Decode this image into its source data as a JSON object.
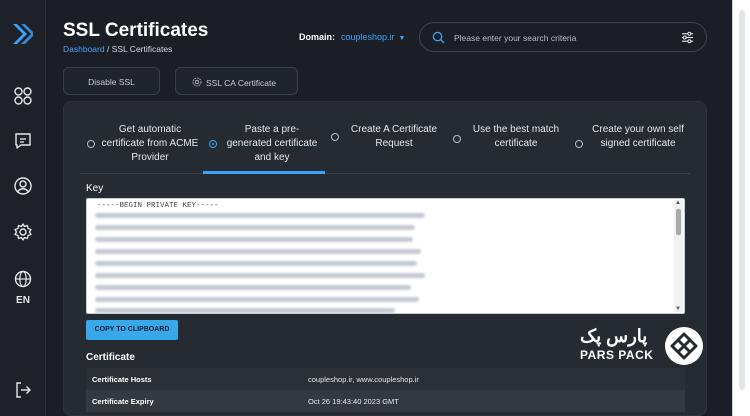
{
  "header": {
    "title": "SSL Certificates",
    "breadcrumb_link": "Dashboard",
    "breadcrumb_sep": " / ",
    "breadcrumb_current": "SSL Certificates",
    "domain_label": "Domain:",
    "domain_value": "coupleshop.ir"
  },
  "search": {
    "placeholder": "Please enter your search criteria"
  },
  "toolbar": {
    "disable_ssl": "Disable SSL",
    "ssl_ca_certificate": "SSL CA Certificate"
  },
  "sidebar": {
    "language": "EN"
  },
  "tabs": [
    {
      "label": "Get automatic certificate from ACME Provider",
      "selected": false
    },
    {
      "label": "Paste a pre-generated certificate and key",
      "selected": true
    },
    {
      "label": "Create A Certificate Request",
      "selected": false
    },
    {
      "label": "Use the best match certificate",
      "selected": false
    },
    {
      "label": "Create your own self signed certificate",
      "selected": false
    }
  ],
  "key_section": {
    "label": "Key",
    "first_line": "-----BEGIN PRIVATE KEY-----"
  },
  "copy_button": "COPY TO CLIPBOARD",
  "certificate": {
    "label": "Certificate",
    "rows": [
      {
        "key": "Certificate Hosts",
        "value": "coupleshop.ir, www.coupleshop.ir"
      },
      {
        "key": "Certificate Expiry",
        "value": "Oct 26 19:43:40 2023 GMT"
      }
    ]
  },
  "watermark": {
    "persian": "پارس پک",
    "english": "PARS PACK"
  },
  "colors": {
    "accent": "#3aa3ff",
    "button": "#38a8ea",
    "background": "#1b1e24",
    "panel": "#262a31"
  },
  "icons": [
    "logo-icon",
    "dashboard-grid-icon",
    "chat-icon",
    "user-icon",
    "settings-icon",
    "globe-icon",
    "logout-icon",
    "search-icon",
    "filter-icon",
    "gear-icon"
  ]
}
